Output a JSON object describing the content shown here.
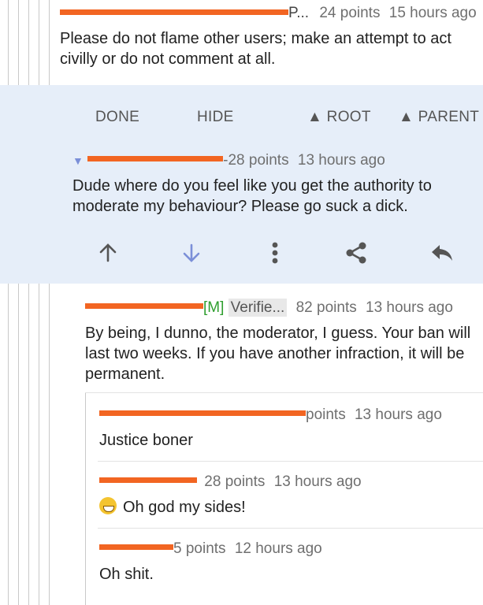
{
  "comment1": {
    "suffix": "P...",
    "points": "24 points",
    "time": "15 hours ago",
    "body": "Please do not flame other users; make an attempt to act civilly or do not comment at all."
  },
  "toolbar": {
    "done": "DONE",
    "hide": "HIDE",
    "root": "▲ ROOT",
    "parent": "▲ PARENT"
  },
  "comment2": {
    "collapse": "▼",
    "points": "-28 points",
    "time": "13 hours ago",
    "body": "Dude where do you feel like you get the authority to moderate my behaviour? Please go suck a dick."
  },
  "actions": {
    "upvote": "arrow-up-icon",
    "downvote": "arrow-down-icon",
    "more": "more-vertical-icon",
    "share": "share-icon",
    "reply": "reply-icon"
  },
  "comment3": {
    "mod_tag": "[M]",
    "badge": "Verifie...",
    "points": "82 points",
    "time": "13 hours ago",
    "body": "By being, I dunno, the moderator, I guess. Your ban will last two weeks. If you have another infraction, it will be permanent."
  },
  "comment4": {
    "points": "points",
    "time": "13 hours ago",
    "body": "Justice boner"
  },
  "comment5": {
    "points": "28 points",
    "time": "13 hours ago",
    "emoji": "grinning-squinting-face-icon",
    "body": "Oh god my sides!"
  },
  "comment6": {
    "points": "5 points",
    "time": "12 hours ago",
    "body": "Oh shit."
  },
  "colors": {
    "accent_orange": "#f26522",
    "active_bg": "#e6eef9",
    "upvote_dark": "#555555",
    "downvote_blue": "#7b8fd8",
    "mod_green": "#2e9e2e"
  }
}
